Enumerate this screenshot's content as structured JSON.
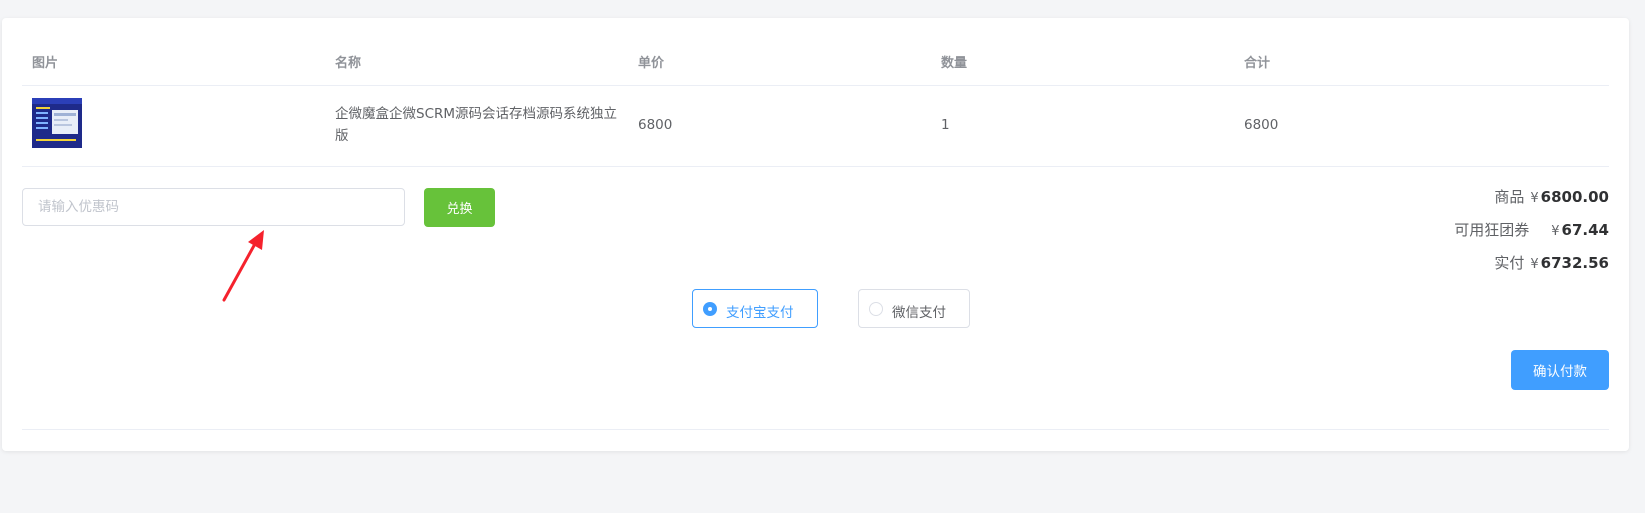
{
  "table": {
    "headers": [
      "图片",
      "名称",
      "单价",
      "数量",
      "合计"
    ],
    "rows": [
      {
        "name_line1": "企微魔盒企微SCRM源码会话存档源码系统独立",
        "name_line2": "版",
        "price": "6800",
        "quantity": "1",
        "total": "6800"
      }
    ]
  },
  "coupon": {
    "placeholder": "请输入优惠码",
    "value": "",
    "button_label": "兑换"
  },
  "summary": {
    "goods_label": "商品",
    "goods_value": "6800.00",
    "voucher_label": "可用狂团券",
    "voucher_value": "67.44",
    "paid_label": "实付",
    "paid_value": "6732.56",
    "currency": "¥"
  },
  "payment": {
    "options": [
      {
        "label": "支付宝支付",
        "selected": true
      },
      {
        "label": "微信支付",
        "selected": false
      }
    ]
  },
  "confirm_label": "确认付款",
  "colors": {
    "primary": "#409eff",
    "success": "#67c23a",
    "annotation": "#f5222d"
  }
}
